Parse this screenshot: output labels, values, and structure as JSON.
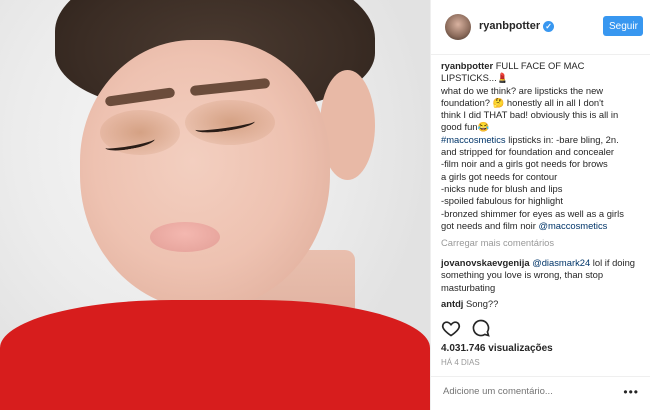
{
  "post": {
    "username": "ryanbpotter",
    "verified_icon": "verified-badge-icon",
    "follow_label": "Seguir",
    "caption_user": "ryanbpotter",
    "caption_lines": [
      "FULL FACE OF MAC",
      "LIPSTICKS...💄",
      "what do we think? are lipsticks the new",
      "foundation? 🤔 honestly all in all I don't",
      "think I did THAT bad! obviously this is all in",
      "good fun😂"
    ],
    "hashtag": "#maccosmetics",
    "hashtag_rest": "lipsticks in: -bare bling, 2n.",
    "list_lines": [
      "and stripped for foundation and concealer",
      "-film noir and a girls got needs for brows",
      "a girls got needs for contour",
      "-nicks nude for blush and lips",
      "-spoiled fabulous for highlight",
      "-bronzed shimmer for eyes as well as a girls"
    ],
    "last_line_prefix": "got needs and film noir",
    "last_line_mention": "@maccosmetics",
    "load_more": "Carregar mais comentários"
  },
  "comments": [
    {
      "user": "jovanovskaevgenija",
      "mention": "@diasmark24",
      "text": "lol if doing something you love is wrong, than stop masturbating"
    },
    {
      "user": "antdj",
      "mention": "",
      "text": "Song??"
    }
  ],
  "actions": {
    "like_icon": "heart-icon",
    "comment_icon": "comment-icon",
    "views": "4.031.746 visualizações",
    "time_ago": "HÁ 4 DIAS"
  },
  "add_comment": {
    "placeholder": "Adicione um comentário...",
    "more_icon": "more-options-icon"
  },
  "colors": {
    "accent": "#3897f0",
    "shirt": "#d71d1d",
    "link": "#003569"
  }
}
